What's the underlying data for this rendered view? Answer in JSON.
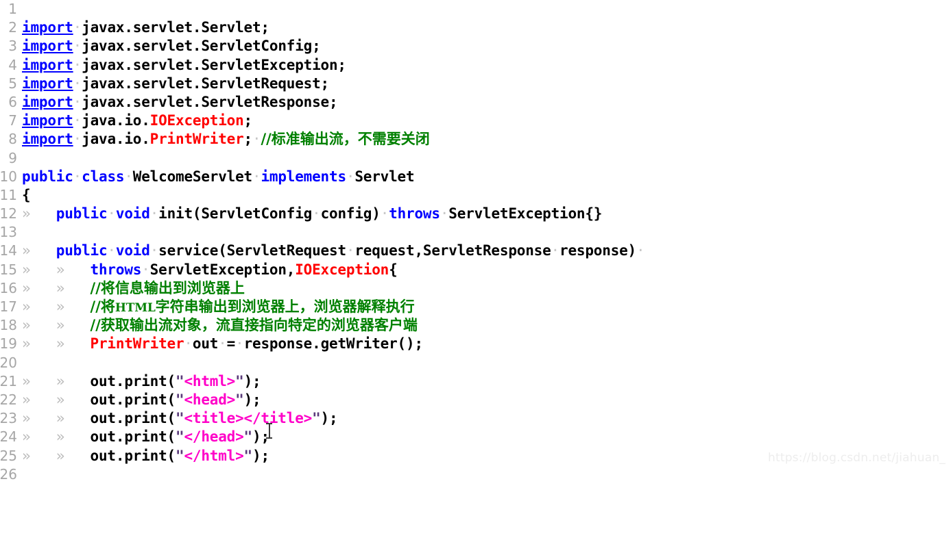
{
  "editor": {
    "app": "code-editor",
    "language": "Java",
    "tab_marker": "»",
    "space_marker": "·",
    "colors": {
      "background": "#ffffff",
      "keyword": "#0000ff",
      "identifier": "#000000",
      "type_exception": "#ff0000",
      "string_literal": "#ff00c8",
      "string_quote": "#5a3a7a",
      "comment": "#008000",
      "line_number": "#a6a6a6",
      "tab_marker": "#bcbcbc",
      "space_marker": "#c8c8c8",
      "watermark": "#ededed"
    },
    "first_visible_line": 1,
    "last_visible_line": 26,
    "lines": [
      {
        "n": 1,
        "text": ""
      },
      {
        "n": 2,
        "text": "import javax.servlet.Servlet;"
      },
      {
        "n": 3,
        "text": "import javax.servlet.ServletConfig;"
      },
      {
        "n": 4,
        "text": "import javax.servlet.ServletException;"
      },
      {
        "n": 5,
        "text": "import javax.servlet.ServletRequest;"
      },
      {
        "n": 6,
        "text": "import javax.servlet.ServletResponse;"
      },
      {
        "n": 7,
        "text": "import java.io.IOException;"
      },
      {
        "n": 8,
        "text": "import java.io.PrintWriter; //标准输出流，不需要关闭"
      },
      {
        "n": 9,
        "text": ""
      },
      {
        "n": 10,
        "text": "public class WelcomeServlet implements Servlet"
      },
      {
        "n": 11,
        "text": "{"
      },
      {
        "n": 12,
        "text": "\tpublic void init(ServletConfig config) throws ServletException{}"
      },
      {
        "n": 13,
        "text": ""
      },
      {
        "n": 14,
        "text": "\tpublic void service(ServletRequest request,ServletResponse response) "
      },
      {
        "n": 15,
        "text": "\t\tthrows ServletException,IOException{"
      },
      {
        "n": 16,
        "text": "\t\t//将信息输出到浏览器上"
      },
      {
        "n": 17,
        "text": "\t\t//将HTML字符串输出到浏览器上，浏览器解释执行"
      },
      {
        "n": 18,
        "text": "\t\t//获取输出流对象，流直接指向特定的浏览器客户端"
      },
      {
        "n": 19,
        "text": "\t\tPrintWriter out = response.getWriter();"
      },
      {
        "n": 20,
        "text": ""
      },
      {
        "n": 21,
        "text": "\t\tout.print(\"<html>\");"
      },
      {
        "n": 22,
        "text": "\t\tout.print(\"<head>\");"
      },
      {
        "n": 23,
        "text": "\t\tout.print(\"<title></title>\");"
      },
      {
        "n": 24,
        "text": "\t\tout.print(\"</head>\");"
      },
      {
        "n": 25,
        "text": "\t\tout.print(\"</html>\");"
      },
      {
        "n": 26,
        "text": ""
      }
    ],
    "line_numbers": [
      "1",
      "2",
      "3",
      "4",
      "5",
      "6",
      "7",
      "8",
      "9",
      "10",
      "11",
      "12",
      "13",
      "14",
      "15",
      "16",
      "17",
      "18",
      "19",
      "20",
      "21",
      "22",
      "23",
      "24",
      "25",
      "26"
    ],
    "tokens": {
      "kw_import": "import",
      "kw_public": "public",
      "kw_class": "class",
      "kw_void": "void",
      "kw_implements": "implements",
      "kw_throws": "throws",
      "type_ioexception": "IOException",
      "type_printwriter": "PrintWriter",
      "class_name": "WelcomeServlet",
      "interface_name": "Servlet"
    },
    "comments": {
      "line8": "//标准输出流，不需要关闭",
      "line16": "//将信息输出到浏览器上",
      "line17_pre": "//将",
      "line17_html": "HTML",
      "line17_post": "字符串输出到浏览器上，浏览器解释执行",
      "line18": "//获取输出流对象，流直接指向特定的浏览器客户端"
    },
    "strings": {
      "html_open": "<html>",
      "head_open": "<head>",
      "title_pair": "<title></title>",
      "head_close": "</head>",
      "html_close": "</html>"
    }
  },
  "watermark": {
    "text": "https://blog.csdn.net/jiahuan_"
  },
  "cursor": {
    "type": "i-beam",
    "on_line": 24
  }
}
